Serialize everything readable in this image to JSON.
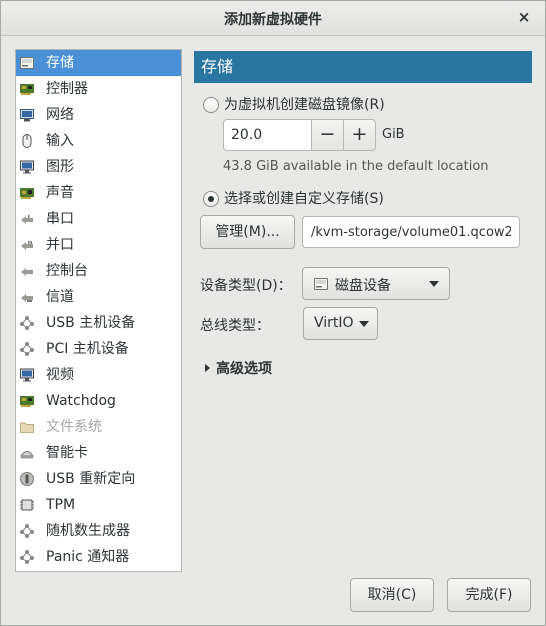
{
  "window": {
    "title": "添加新虚拟硬件",
    "close_glyph": "×"
  },
  "sidebar": {
    "items": [
      {
        "label": "存储",
        "icon": "disk-icon",
        "selected": true
      },
      {
        "label": "控制器",
        "icon": "controller-card-icon"
      },
      {
        "label": "网络",
        "icon": "network-card-icon"
      },
      {
        "label": "输入",
        "icon": "mouse-icon"
      },
      {
        "label": "图形",
        "icon": "monitor-icon"
      },
      {
        "label": "声音",
        "icon": "sound-card-icon"
      },
      {
        "label": "串口",
        "icon": "serial-port-icon"
      },
      {
        "label": "并口",
        "icon": "parallel-port-icon"
      },
      {
        "label": "控制台",
        "icon": "console-port-icon"
      },
      {
        "label": "信道",
        "icon": "channel-port-icon"
      },
      {
        "label": "USB 主机设备",
        "icon": "usb-host-icon"
      },
      {
        "label": "PCI 主机设备",
        "icon": "pci-host-icon"
      },
      {
        "label": "视频",
        "icon": "video-monitor-icon"
      },
      {
        "label": "Watchdog",
        "icon": "watchdog-card-icon"
      },
      {
        "label": "文件系统",
        "icon": "folder-icon",
        "disabled": true
      },
      {
        "label": "智能卡",
        "icon": "smartcard-reader-icon"
      },
      {
        "label": "USB 重新定向",
        "icon": "usb-redirect-icon"
      },
      {
        "label": "TPM",
        "icon": "tpm-chip-icon"
      },
      {
        "label": "随机数生成器",
        "icon": "rng-icon"
      },
      {
        "label": "Panic 通知器",
        "icon": "panic-notifier-icon"
      }
    ]
  },
  "main": {
    "header": "存储",
    "create_disk_label": "为虚拟机创建磁盘镜像(R)",
    "create_disk_selected": false,
    "size_value": "20.0",
    "minus_label": "−",
    "plus_label": "+",
    "size_unit": "GiB",
    "available_text": "43.8 GiB available in the default location",
    "custom_storage_label": "选择或创建自定义存储(S)",
    "custom_storage_selected": true,
    "manage_button": "管理(M)...",
    "path_value": "/kvm-storage/volume01.qcow2",
    "device_type_label": "设备类型(D)：",
    "device_type_value": "磁盘设备",
    "bus_type_label": "总线类型：",
    "bus_type_value": "VirtIO",
    "advanced_label": "高级选项"
  },
  "footer": {
    "cancel_button": "取消(C)",
    "finish_button": "完成(F)"
  },
  "colors": {
    "selection": "#4a90d9",
    "header": "#2a76a3",
    "window_bg": "#e8e8e7"
  }
}
